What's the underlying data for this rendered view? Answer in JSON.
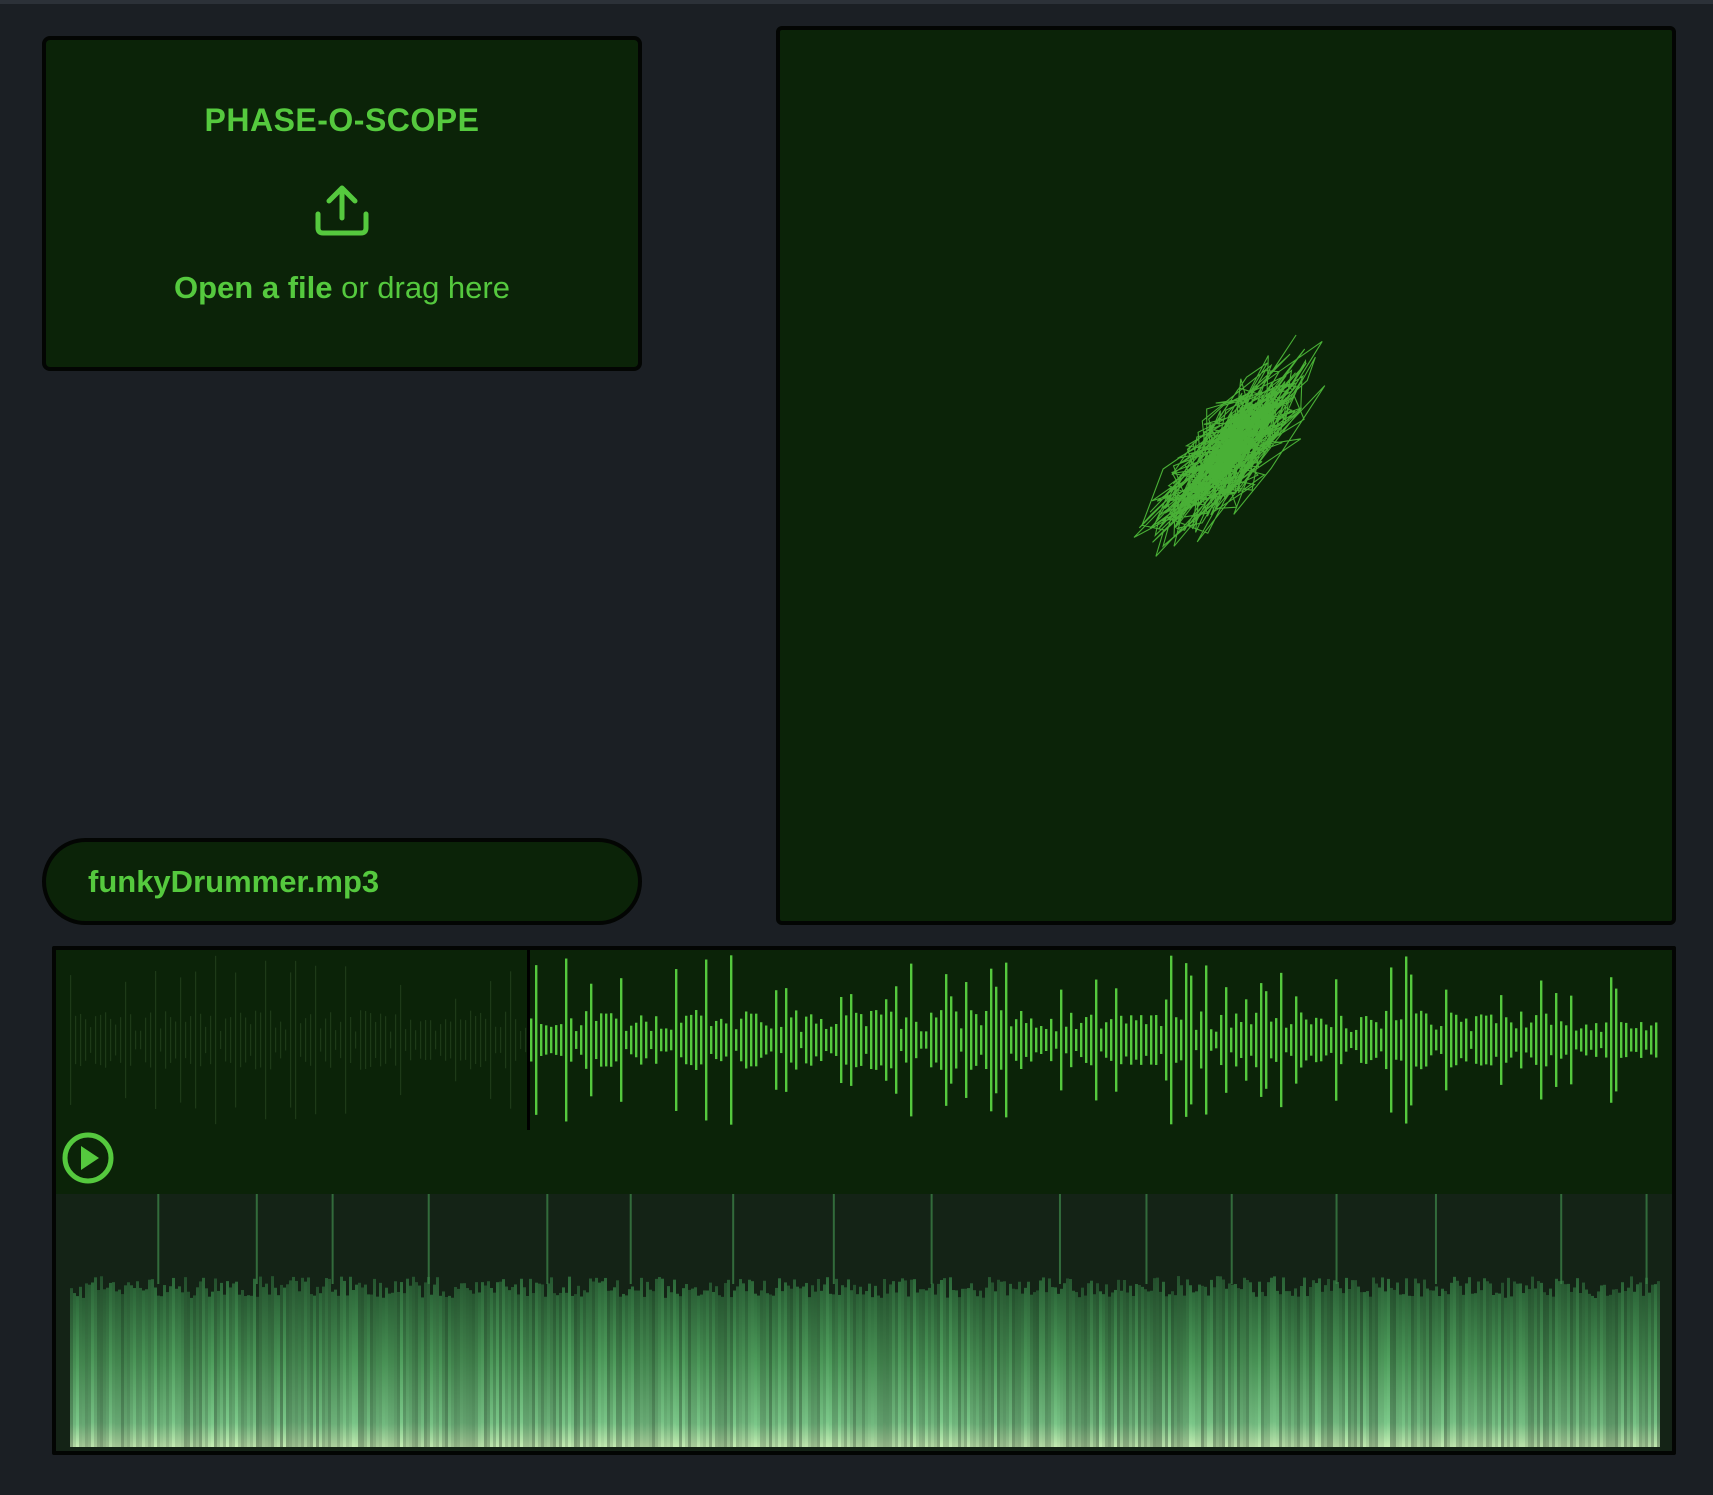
{
  "dropzone": {
    "title": "PHASE-O-SCOPE",
    "icon": "upload-icon",
    "link_text": "Open a file",
    "hint_text": " or drag here"
  },
  "file": {
    "name": "funkyDrummer.mp3"
  },
  "player": {
    "play_icon": "play-circle-icon",
    "progress": 0.29
  },
  "colors": {
    "background": "#1b1f24",
    "panel": "#0b2308",
    "accent": "#55c93e",
    "waveform_played": "#1e3a18",
    "spectrogram": "#5fb56a"
  }
}
